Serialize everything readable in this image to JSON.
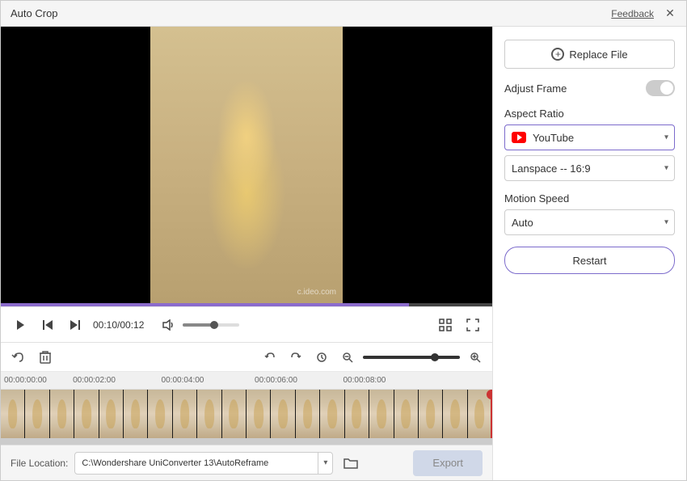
{
  "window": {
    "title": "Auto Crop",
    "feedback": "Feedback"
  },
  "rightPanel": {
    "replaceFile": "Replace File",
    "adjustFrame": "Adjust Frame",
    "aspectRatio": "Aspect Ratio",
    "youtubeLabel": "YouTube",
    "landscapeOption": "Lanspace -- 16:9",
    "motionSpeed": "Motion Speed",
    "motionSpeedValue": "Auto",
    "restartLabel": "Restart"
  },
  "controls": {
    "timeDisplay": "00:10/00:12",
    "playhead": "83%"
  },
  "timeline": {
    "markers": [
      "00:00:00:00",
      "00:00:02:00",
      "00:00:04:00",
      "00:00:06:00",
      "00:00:08:00"
    ]
  },
  "bottomBar": {
    "fileLocationLabel": "File Location:",
    "filePath": "C:\\Wondershare UniConverter 13\\AutoReframe",
    "exportLabel": "Export"
  },
  "watermark": "c.ideo.com"
}
